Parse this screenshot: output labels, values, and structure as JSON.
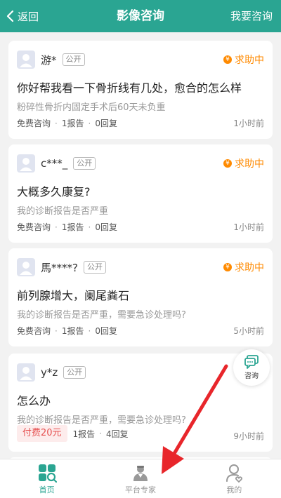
{
  "header": {
    "back_label": "返回",
    "title": "影像咨询",
    "ask_label": "我要咨询"
  },
  "colors": {
    "brand": "#2aa592",
    "status": "#ff8a00",
    "paid": "#e65050"
  },
  "cards": [
    {
      "user": "游*",
      "visibility": "公开",
      "status": "求助中",
      "question": "你好帮我看一下骨折线有几处，愈合的怎么样",
      "desc": "粉碎性骨折内固定手术后60天未负重",
      "type": "免费咨询",
      "reports": "1报告",
      "replies": "0回复",
      "time": "1小时前"
    },
    {
      "user": "c***_",
      "visibility": "公开",
      "status": "求助中",
      "question": "大概多久康复?",
      "desc": "我的诊断报告是否严重",
      "type": "免费咨询",
      "reports": "1报告",
      "replies": "0回复",
      "time": "1小时前"
    },
    {
      "user": "馬****?",
      "visibility": "公开",
      "status": "求助中",
      "question": "前列腺增大，阑尾粪石",
      "desc": "我的诊断报告是否严重，需要急诊处理吗?",
      "type": "免费咨询",
      "reports": "1报告",
      "replies": "0回复",
      "time": "5小时前"
    },
    {
      "user": "y*z",
      "visibility": "公开",
      "question": "怎么办",
      "desc": "我的诊断报告是否严重，需要急诊处理吗?",
      "paid_label": "付费20元",
      "reports": "1报告",
      "replies": "4回复",
      "time": "9小时前"
    }
  ],
  "float_button": {
    "label": "咨询",
    "icon": "chat-icon"
  },
  "tabs": [
    {
      "label": "首页",
      "icon": "home-grid-icon",
      "active": true
    },
    {
      "label": "平台专家",
      "icon": "doctor-icon",
      "active": false
    },
    {
      "label": "我的",
      "icon": "profile-icon",
      "active": false
    }
  ]
}
